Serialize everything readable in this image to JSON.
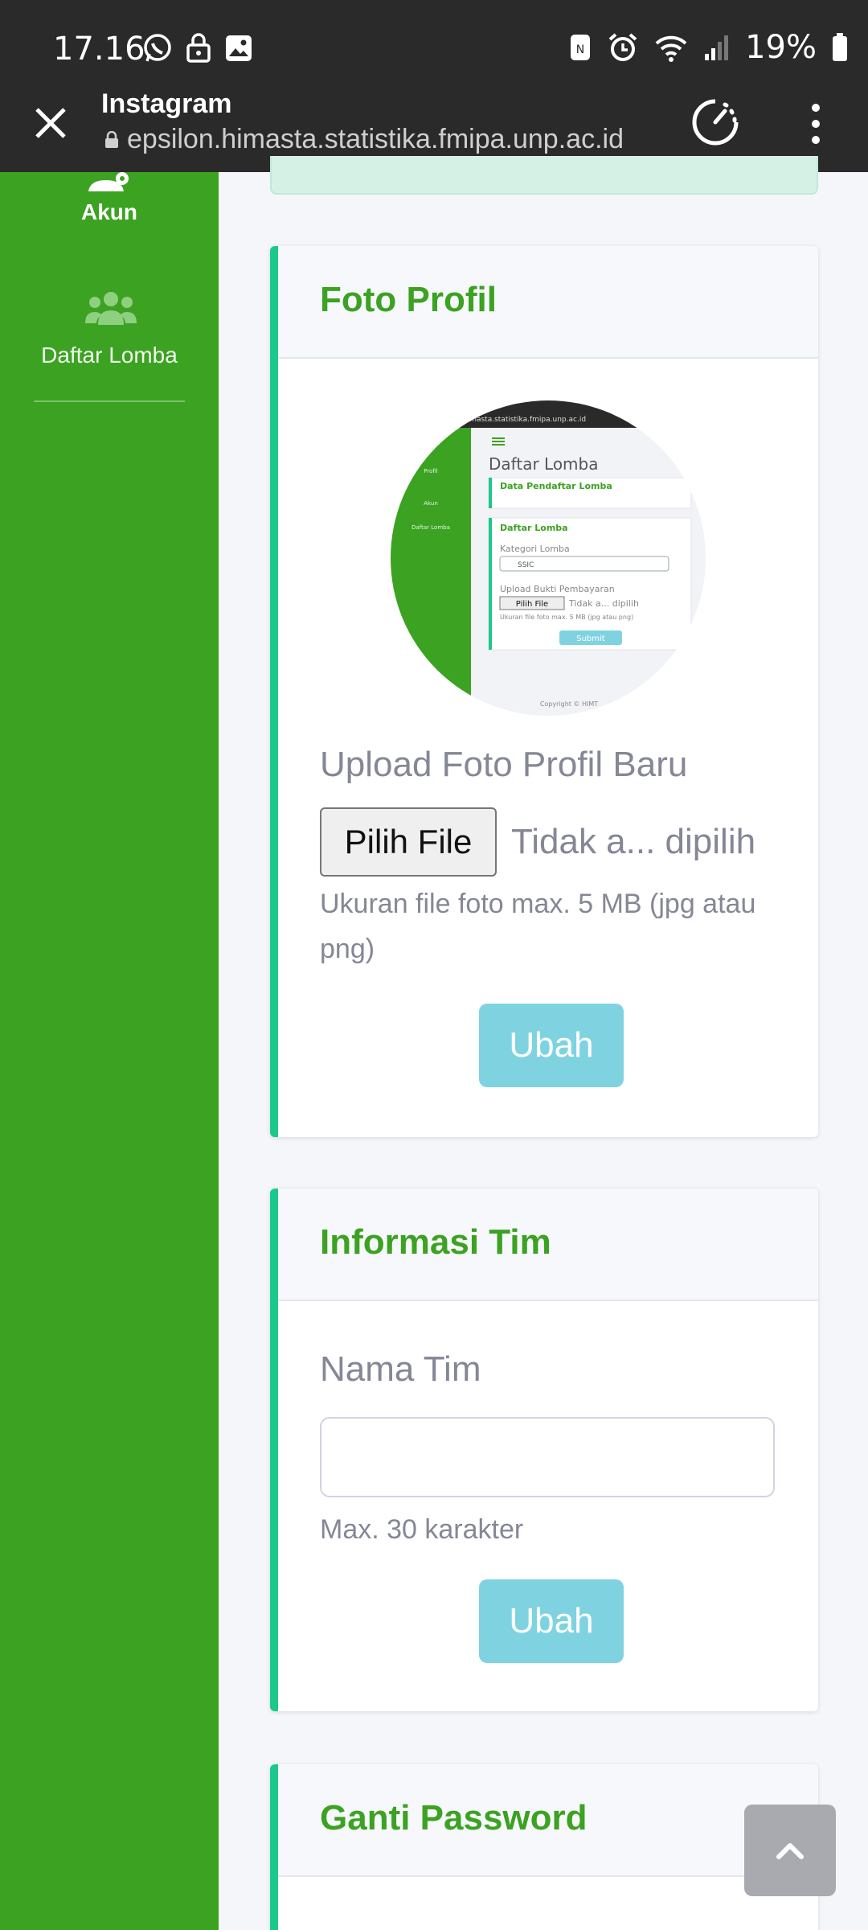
{
  "status_bar": {
    "time": "17.16",
    "battery": "19%"
  },
  "browser": {
    "title": "Instagram",
    "url": "epsilon.himasta.statistika.fmipa.unp.ac.id"
  },
  "sidebar": {
    "items": [
      {
        "label": "Akun",
        "icon": "user-cog-icon"
      },
      {
        "label": "Daftar Lomba",
        "icon": "users-icon"
      }
    ]
  },
  "cards": {
    "foto_profil": {
      "title": "Foto Profil",
      "upload_label": "Upload Foto Profil Baru",
      "file_button": "Pilih File",
      "file_status": "Tidak a... dipilih",
      "help": "Ukuran file foto max. 5 MB (jpg atau png)",
      "submit": "Ubah",
      "thumbnail": {
        "url": "himasta.statistika.fmipa.unp.ac.id",
        "page_title": "Daftar Lomba",
        "section1": "Data Pendaftar Lomba",
        "section2": "Daftar Lomba",
        "category_label": "Kategori Lomba",
        "category_value": "SSIC",
        "upload_label": "Upload Bukti Pembayaran",
        "file_btn": "Pilih File",
        "file_status": "Tidak a... dipilih",
        "help": "Ukuran file foto max. 5 MB (jpg atau png)",
        "submit": "Submit",
        "footer": "Copyright © HIMT",
        "side_item1": "Profil",
        "side_item2": "Akun",
        "side_item3": "Daftar Lomba"
      }
    },
    "informasi_tim": {
      "title": "Informasi Tim",
      "label": "Nama Tim",
      "value": "",
      "help": "Max. 30 karakter",
      "submit": "Ubah"
    },
    "ganti_password": {
      "title": "Ganti Password"
    }
  },
  "colors": {
    "sidebar_green": "#3ca222",
    "card_accent": "#1cc88a",
    "button_info": "#7fd3e0",
    "title_green": "#3ca222"
  }
}
